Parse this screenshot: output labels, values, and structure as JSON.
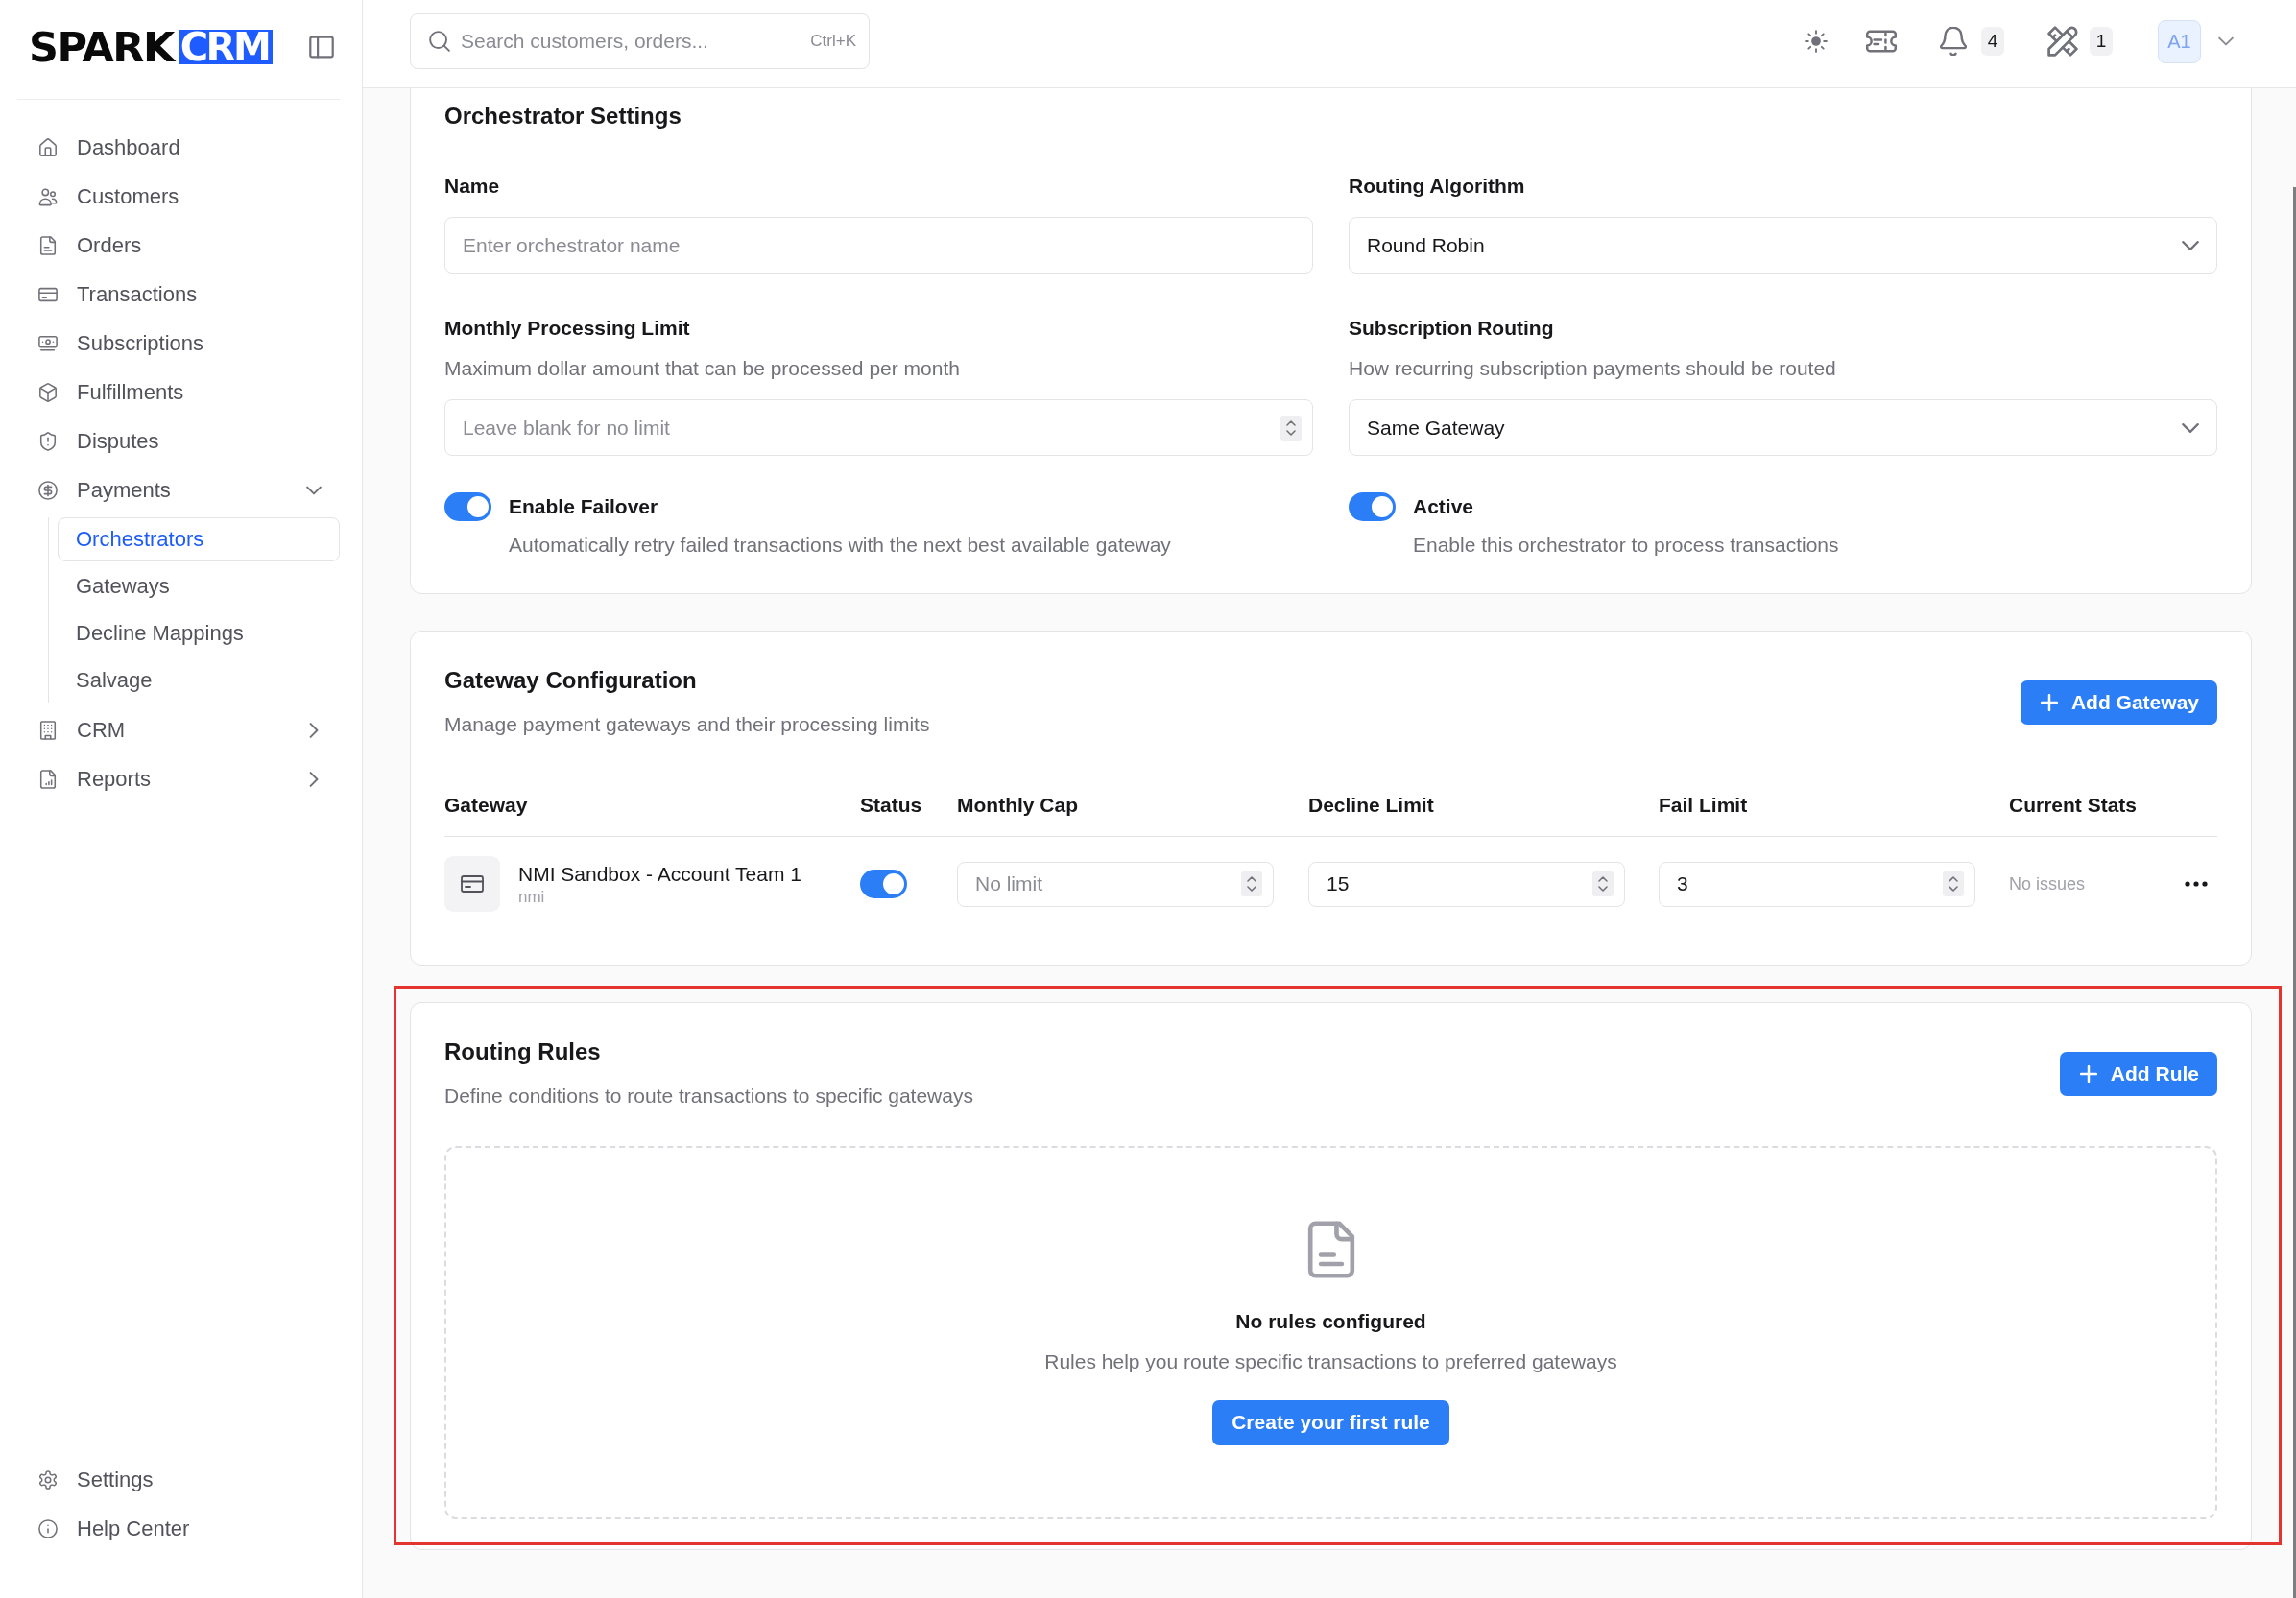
{
  "sidebar": {
    "logo": {
      "text": "SPARK",
      "badge": "CRM"
    },
    "items": [
      {
        "label": "Dashboard",
        "selected": false
      },
      {
        "label": "Customers",
        "selected": false
      },
      {
        "label": "Orders",
        "selected": false
      },
      {
        "label": "Transactions",
        "selected": false
      },
      {
        "label": "Subscriptions",
        "selected": false
      },
      {
        "label": "Fulfillments",
        "selected": false
      },
      {
        "label": "Disputes",
        "selected": false
      },
      {
        "label": "Payments",
        "selected": false,
        "expanded": true,
        "children": [
          {
            "label": "Orchestrators",
            "selected": true
          },
          {
            "label": "Gateways",
            "selected": false
          },
          {
            "label": "Decline Mappings",
            "selected": false
          },
          {
            "label": "Salvage",
            "selected": false
          }
        ]
      },
      {
        "label": "CRM",
        "selected": false,
        "expanded": false
      },
      {
        "label": "Reports",
        "selected": false,
        "expanded": false
      }
    ],
    "footer_items": [
      {
        "label": "Settings",
        "selected": false
      },
      {
        "label": "Help Center",
        "selected": false
      }
    ]
  },
  "top_bar": {
    "search": {
      "placeholder": "Search customers, orders...",
      "shortcut": "Ctrl+K"
    },
    "notification_count": "4",
    "tools_count": "1",
    "avatar": "A1"
  },
  "orchestrator_settings": {
    "title": "Orchestrator Settings",
    "fields": [
      {
        "kind": "text",
        "label": "Name",
        "placeholder": "Enter orchestrator name"
      },
      {
        "kind": "select",
        "label": "Routing Algorithm",
        "value": "Round Robin"
      },
      {
        "kind": "number",
        "label": "Monthly Processing Limit",
        "description": "Maximum dollar amount that can be processed per month",
        "placeholder": "Leave blank for no limit"
      },
      {
        "kind": "select",
        "label": "Subscription Routing",
        "description": "How recurring subscription payments should be routed",
        "value": "Same Gateway"
      }
    ],
    "toggles": [
      {
        "label": "Enable Failover",
        "description": "Automatically retry failed transactions with the next best available gateway",
        "on": true
      },
      {
        "label": "Active",
        "description": "Enable this orchestrator to process transactions",
        "on": true
      }
    ]
  },
  "gateway_configuration": {
    "title": "Gateway Configuration",
    "description": "Manage payment gateways and their processing limits",
    "add_button": "Add Gateway",
    "table": {
      "columns": [
        "Gateway",
        "Status",
        "Monthly Cap",
        "Decline Limit",
        "Fail Limit",
        "Current Stats"
      ],
      "rows": [
        {
          "name": "NMI Sandbox - Account Team 1",
          "type": "nmi",
          "on": true,
          "monthly_cap": {
            "placeholder": "No limit"
          },
          "decline_limit": {
            "value": "15"
          },
          "fail_limit": {
            "value": "3"
          },
          "current_stats": "No issues"
        }
      ]
    }
  },
  "routing_rules": {
    "title": "Routing Rules",
    "description": "Define conditions to route transactions to specific gateways",
    "add_button": "Add Rule",
    "highlighted": true,
    "empty_state": {
      "title": "No rules configured",
      "message": "Rules help you route specific transactions to preferred gateways",
      "button": "Create your first rule"
    }
  }
}
